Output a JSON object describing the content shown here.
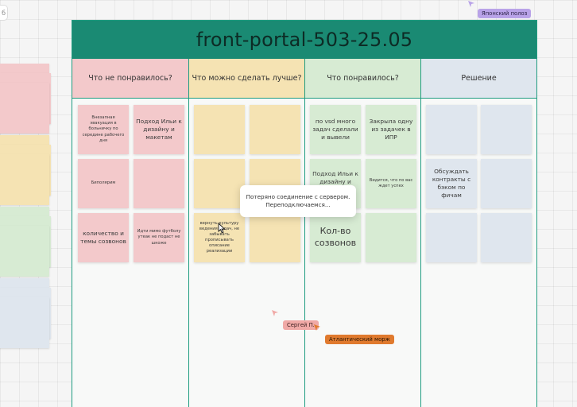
{
  "top_left_chip": "б",
  "board": {
    "title": "front-portal-503-25.05",
    "columns": [
      {
        "header": "Что не понравилось?",
        "notes": [
          "Внезапная эвакуация в больничку по середине рабочего дня",
          "Подход Ильи к дизайну и макетам",
          "Биполярим",
          "",
          "количество и темы созвонов",
          "Идти мимо футболу утеак не подаст не шкоже"
        ]
      },
      {
        "header": "Что можно сделать лучше?",
        "notes": [
          "",
          "",
          "",
          "",
          "вернуть культуру ведения задач, не забывать прописывать описание реализации",
          ""
        ]
      },
      {
        "header": "Что понравилось?",
        "notes": [
          "по vsd много задач сделали и вывели",
          "Закрыла одну из задачек в ИПР",
          "Подход Ильи к дизайну и",
          "Видится, что по вас ждет успех",
          "Кол-во созвонов",
          ""
        ]
      },
      {
        "header": "Решение",
        "notes": [
          "",
          "",
          "",
          "Обсуждать контракты с бэком по фичам",
          "",
          ""
        ]
      }
    ]
  },
  "dialog": {
    "line1": "Потеряно соединение с сервером.",
    "line2": "Переподключаемся..."
  },
  "cursors": [
    {
      "label": "Японский полоз",
      "color": "#b9a3e8"
    },
    {
      "label": "Сергей П.",
      "color": "#f0a9a6"
    },
    {
      "label": "Атлантический морж",
      "color": "#e07a2e"
    }
  ],
  "colors": {
    "header": "#1a8a73",
    "border": "#1f9c80",
    "pink": "#f3c9cb",
    "yellow": "#f5e3b3",
    "green": "#d7ebd3",
    "blue": "#dfe6ee"
  }
}
